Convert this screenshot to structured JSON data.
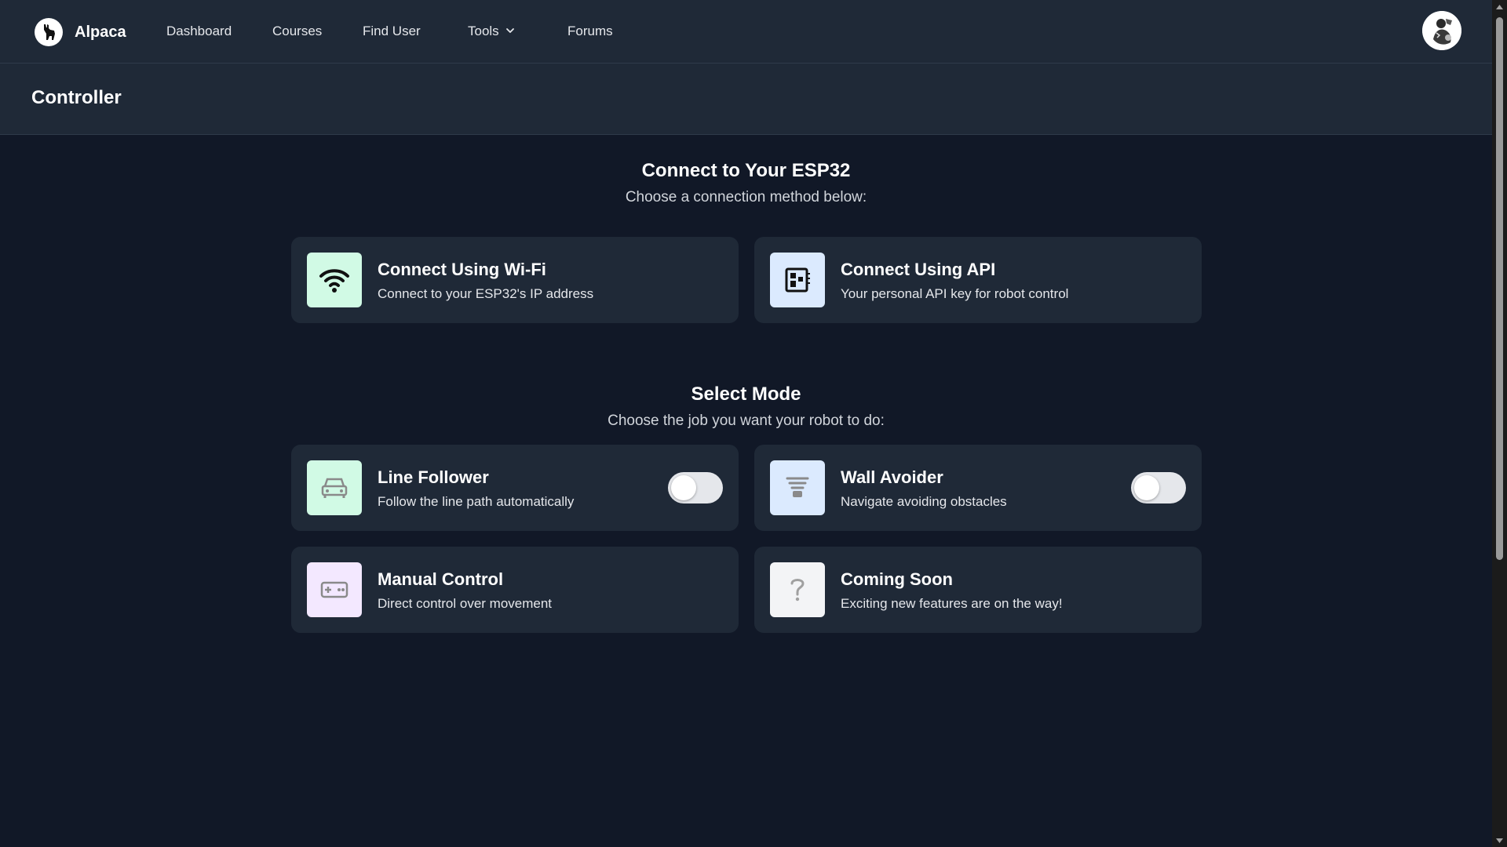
{
  "nav": {
    "brand": "Alpaca",
    "links": {
      "dashboard": "Dashboard",
      "courses": "Courses",
      "find_user": "Find User",
      "tools": "Tools",
      "forums": "Forums"
    }
  },
  "header": {
    "title": "Controller"
  },
  "connect": {
    "title": "Connect to Your ESP32",
    "subtitle": "Choose a connection method below:",
    "cards": [
      {
        "title": "Connect Using Wi-Fi",
        "description": "Connect to your ESP32's IP address",
        "icon": "wifi-icon",
        "icon_bg": "#d1fae5"
      },
      {
        "title": "Connect Using API",
        "description": "Your personal API key for robot control",
        "icon": "api-chip-icon",
        "icon_bg": "#dbeafe"
      }
    ]
  },
  "modes": {
    "title": "Select Mode",
    "subtitle": "Choose the job you want your robot to do:",
    "cards": [
      {
        "title": "Line Follower",
        "description": "Follow the line path automatically",
        "icon": "car-icon",
        "icon_bg": "#d1fae5",
        "toggle_on": false
      },
      {
        "title": "Wall Avoider",
        "description": "Navigate avoiding obstacles",
        "icon": "sensor-icon",
        "icon_bg": "#dbeafe",
        "toggle_on": false
      },
      {
        "title": "Manual Control",
        "description": "Direct control over movement",
        "icon": "gamepad-icon",
        "icon_bg": "#f3e8ff"
      },
      {
        "title": "Coming Soon",
        "description": "Exciting new features are on the way!",
        "icon": "question-icon",
        "icon_bg": "#f3f4f6"
      }
    ]
  },
  "colors": {
    "background": "#111827",
    "surface": "#1f2937",
    "text": "#ffffff",
    "muted_text": "#d1d5db"
  }
}
